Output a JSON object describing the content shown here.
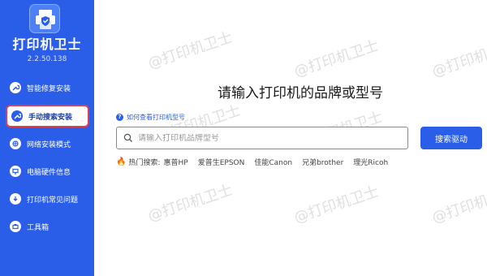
{
  "app": {
    "name": "打印机卫士",
    "version": "2.2.50.138"
  },
  "sidebar": {
    "items": [
      {
        "label": "智能修复安装",
        "icon": "wrench-repair-icon",
        "active": false
      },
      {
        "label": "手动搜索安装",
        "icon": "wrench-icon",
        "active": true
      },
      {
        "label": "网络安装模式",
        "icon": "network-icon",
        "active": false
      },
      {
        "label": "电脑硬件信息",
        "icon": "hardware-icon",
        "active": false
      },
      {
        "label": "打印机常见问题",
        "icon": "help-download-icon",
        "active": false
      },
      {
        "label": "工具箱",
        "icon": "toolbox-icon",
        "active": false
      }
    ]
  },
  "main": {
    "title": "请输入打印机的品牌或型号",
    "help_link": "如何查看打印机型号",
    "search": {
      "placeholder": "请输入打印机品牌型号",
      "value": "",
      "button_label": "搜索驱动"
    },
    "hot_search": {
      "label": "热门搜索:",
      "brands": [
        "惠普HP",
        "爱普生EPSON",
        "佳能Canon",
        "兄弟brother",
        "理光Ricoh"
      ]
    }
  },
  "watermark": {
    "text": "@打印机卫士"
  },
  "colors": {
    "sidebar": "#2a5ee8",
    "accent": "#2a5ee8",
    "active_border": "#e0404a",
    "fire": "#f05a1a"
  }
}
